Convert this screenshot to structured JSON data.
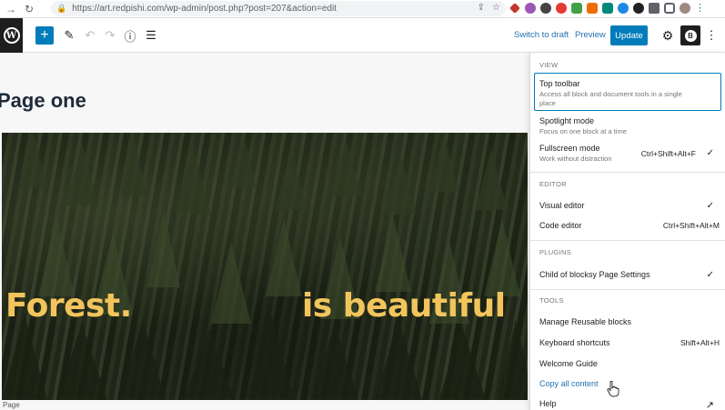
{
  "browser": {
    "url": "https://art.redpishi.com/wp-admin/post.php?post=207&action=edit"
  },
  "header": {
    "switch_to_draft": "Switch to draft",
    "preview": "Preview",
    "update": "Update"
  },
  "canvas": {
    "page_title": "Page one",
    "cover_text_left": "Forest.",
    "cover_text_right": "is beautiful",
    "status_label": "Page"
  },
  "menu": {
    "view": {
      "label": "VIEW",
      "items": [
        {
          "label": "Top toolbar",
          "desc": "Access all block and document tools in a single place"
        },
        {
          "label": "Spotlight mode",
          "desc": "Focus on one block at a time"
        },
        {
          "label": "Fullscreen mode",
          "desc": "Work without distraction",
          "shortcut": "Ctrl+Shift+Alt+F",
          "check": "✓"
        }
      ]
    },
    "editor": {
      "label": "EDITOR",
      "items": [
        {
          "label": "Visual editor",
          "check": "✓"
        },
        {
          "label": "Code editor",
          "shortcut": "Ctrl+Shift+Alt+M"
        }
      ]
    },
    "plugins": {
      "label": "PLUGINS",
      "items": [
        {
          "label": "Child of blocksy Page Settings",
          "check": "✓"
        }
      ]
    },
    "tools": {
      "label": "TOOLS",
      "items": [
        {
          "label": "Manage Reusable blocks"
        },
        {
          "label": "Keyboard shortcuts",
          "shortcut": "Shift+Alt+H"
        },
        {
          "label": "Welcome Guide"
        },
        {
          "label": "Copy all content"
        },
        {
          "label": "Help"
        }
      ]
    }
  },
  "colors": {
    "wp_blue": "#007cba",
    "link_blue": "#2271b1",
    "cover_text": "#f2c55c"
  }
}
